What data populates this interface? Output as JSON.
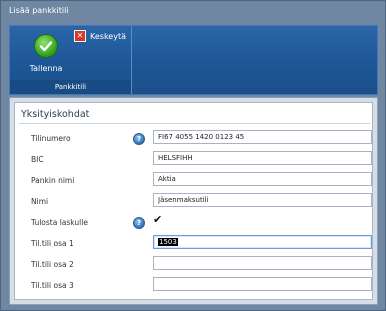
{
  "window": {
    "title": "Lisää pankkitili"
  },
  "toolbar": {
    "save_label": "Tallenna",
    "cancel_label": "Keskeytä",
    "group_label": "Pankkitili"
  },
  "section": {
    "title": "Yksityiskohdat"
  },
  "fields": [
    {
      "label": "Tilinumero",
      "value": "FI67 4055 1420 0123 45",
      "help": true
    },
    {
      "label": "BIC",
      "value": "HELSFIHH"
    },
    {
      "label": "Pankin nimi",
      "value": "Aktia"
    },
    {
      "label": "Nimi",
      "value": "Jäsenmaksutili"
    },
    {
      "label": "Tulosta laskulle",
      "checked": true,
      "help": true,
      "check_glyph": "✔"
    },
    {
      "label": "Til.tili osa 1",
      "value": "1503",
      "focused": true
    },
    {
      "label": "Til.tili osa 2",
      "value": ""
    },
    {
      "label": "Til.tili osa 3",
      "value": ""
    }
  ],
  "icons": {
    "help_glyph": "?",
    "cancel_glyph": "✕"
  },
  "colors": {
    "ribbon": "#1e5797",
    "save_green": "#2f9c1c",
    "cancel_red": "#d9372a",
    "dialog_frame": "#6f87a1"
  }
}
